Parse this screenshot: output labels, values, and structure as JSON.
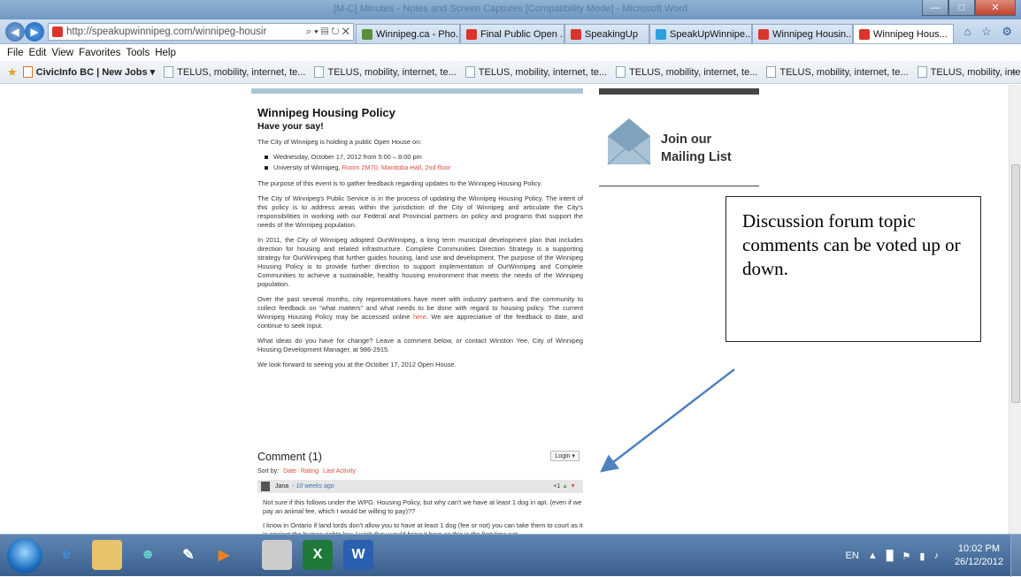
{
  "browser": {
    "window_title": "[M-C] Minutes - Notes and Screen Captures [Compatibility Mode] - Microsoft Word",
    "url": "http://speakupwinnipeg.com/winnipeg-housir",
    "addr_ctrls": "⌕ ▾ ▤ ↻ ✕",
    "tabs": [
      {
        "label": "Winnipeg.ca - Pho...",
        "color": "#5a8f3a"
      },
      {
        "label": "Final Public Open ...",
        "color": "#d9352b"
      },
      {
        "label": "SpeakingUp",
        "color": "#d9352b"
      },
      {
        "label": "SpeakUpWinnipe...",
        "color": "#2b9fe0"
      },
      {
        "label": "Winnipeg Housin...",
        "color": "#d9352b"
      },
      {
        "label": "Winnipeg Hous...",
        "color": "#d9352b",
        "close": "✕"
      }
    ],
    "nav_icons": "⌂ ☆ ⚙",
    "menu": [
      "File",
      "Edit",
      "View",
      "Favorites",
      "Tools",
      "Help"
    ],
    "favorites": {
      "civic": "CivicInfo BC | New Jobs ▾",
      "items": [
        "TELUS, mobility, internet, te...",
        "TELUS, mobility, internet, te...",
        "TELUS, mobility, internet, te...",
        "TELUS, mobility, internet, te...",
        "TELUS, mobility, internet, te...",
        "TELUS, mobility, internet, te..."
      ],
      "more": "»"
    }
  },
  "article": {
    "title": "Winnipeg Housing Policy",
    "subtitle": "Have your say!",
    "intro": "The City of Winnipeg is holding a public Open House on:",
    "bullet1": "Wednesday, October 17, 2012 from 5:00 – 8:00 pm",
    "bullet2_pre": "University of Winnipeg, ",
    "bullet2_red": "Room 2M70, Manitoba Hall, 2nd floor",
    "p1": "The purpose of this event is to gather feedback regarding updates to the Winnipeg Housing Policy.",
    "p2": "The City of Winnipeg's Public Service is in the process of updating the Winnipeg Housing Policy. The intent of this policy is to address areas within the jurisdiction of the City of Winnipeg and articulate the City's responsibilities in working with our Federal and Provincial partners on policy and programs that support the needs of the Winnipeg population.",
    "p3": "In 2011, the City of Winnipeg adopted OurWinnipeg, a long term municipal development plan that includes direction for housing and related infrastructure. Complete Communities Direction Strategy is a supporting strategy for OurWinnipeg that further guides housing, land use and development. The purpose of the Winnipeg Housing Policy is to provide further direction to support implementation of OurWinnipeg and Complete Communities to achieve a sustainable, healthy housing environment that meets the needs of the Winnipeg population.",
    "p4_pre": "Over the past several months, city representatives have meet with industry partners and the community to collect feedback on “what matters” and what needs to be done with regard to housing policy. The current Winnipeg Housing Policy may be accessed online ",
    "p4_link": "here",
    "p4_post": ". We are appreciative of the feedback to date, and continue to seek input.",
    "p5": "What ideas do you have for change? Leave a comment below, or contact Winston Yee, City of Winnipeg Housing Development Manager, at 986-2915.",
    "p6": "We look forward to seeing you at the October 17, 2012 Open House."
  },
  "sidebar": {
    "mailing_line1": "Join our",
    "mailing_line2": "Mailing List"
  },
  "comments": {
    "title": "Comment (1)",
    "login": "Login ▾",
    "sort_label": "Sort by:",
    "sort_options": [
      "Date",
      "Rating",
      "Last Activity"
    ],
    "author": "Jana",
    "time": "- 10 weeks ago",
    "votes": "+1",
    "text1": "Not sure if this follows under the WPG. Housing Policy, but why can't we have at least 1 dog in apt. (even if we pay an animal fee, which I would be willing to pay)??",
    "text2": "I know in Ontario if land lords don't allow you to have at least 1 dog (fee or not) you can take them to court as it is against the human rights law. I wish they would bring it here as this is the first time not"
  },
  "callout": {
    "text": "Discussion forum topic comments can be voted up or down."
  },
  "taskbar": {
    "lang": "EN",
    "time": "10:02 PM",
    "date": "26/12/2012",
    "icons": [
      "windows-start",
      "internet-explorer",
      "file-explorer",
      "users",
      "whiteboard",
      "media",
      "calculator",
      "excel",
      "word"
    ]
  }
}
